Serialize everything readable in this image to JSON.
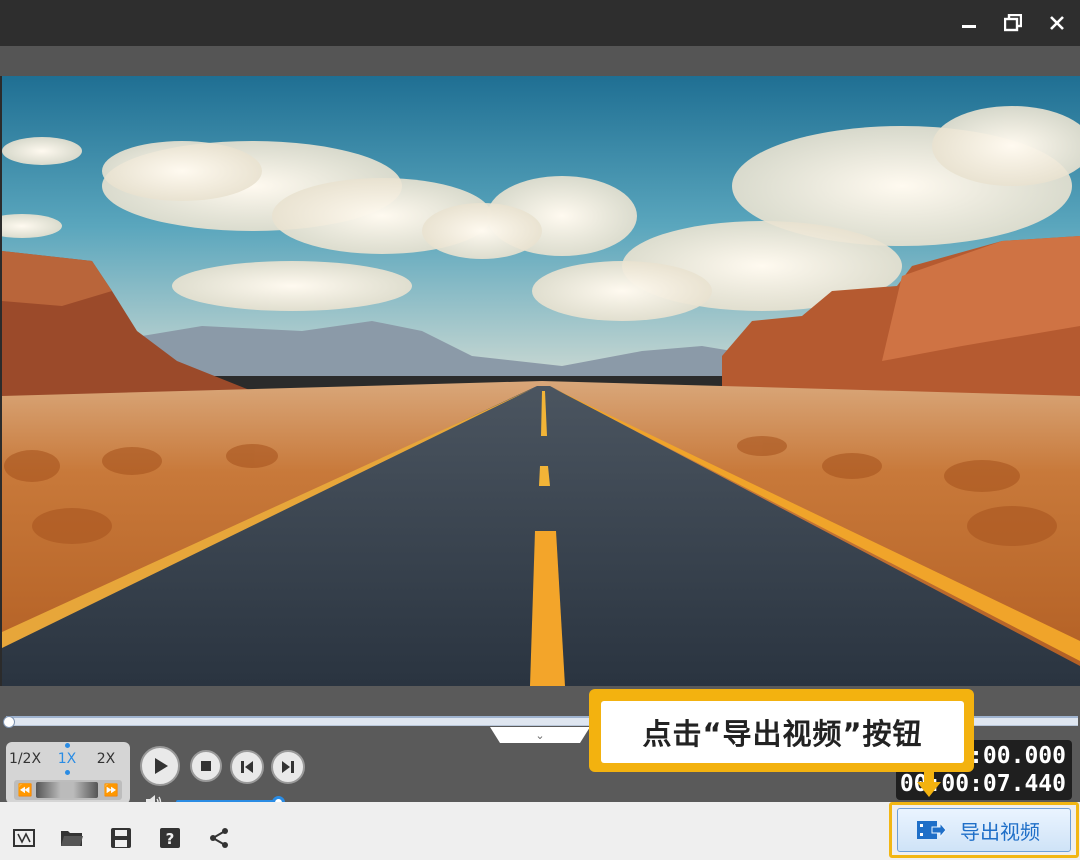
{
  "window": {
    "controls": {
      "minimize": "minimize-icon",
      "restore": "restore-icon",
      "close": "close-icon"
    }
  },
  "playback": {
    "speeds": [
      "1/2X",
      "1X",
      "2X"
    ],
    "selected_speed": "1X",
    "buttons": [
      "play-icon",
      "stop-icon",
      "prev-frame-icon",
      "next-frame-icon"
    ],
    "volume": 1.0,
    "seek_position": 0.0
  },
  "timecode": {
    "current": "00:00:00.000",
    "total": "00:00:07.440"
  },
  "toolbar": {
    "icons": [
      "subtitle-icon",
      "folder-icon",
      "save-icon",
      "help-icon",
      "share-icon"
    ],
    "export_label": "导出视频"
  },
  "callout": {
    "text": "点击“导出视频”按钮"
  },
  "colors": {
    "accent": "#2a8ce4",
    "highlight": "#f2b613"
  }
}
